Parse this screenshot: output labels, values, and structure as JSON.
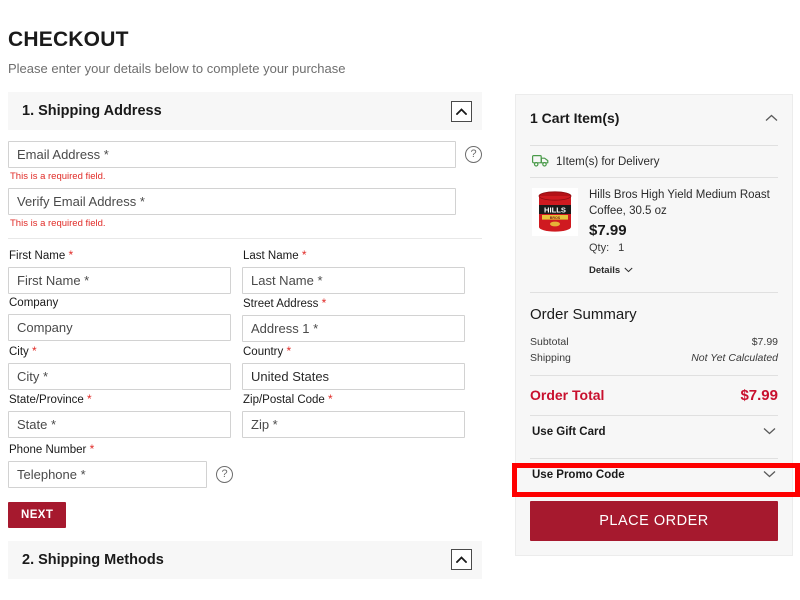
{
  "header": {
    "title": "CHECKOUT",
    "subtitle": "Please enter your details below to complete your purchase"
  },
  "colors": {
    "accent_red": "#c8102e",
    "button_red": "#a6192e",
    "error_red": "#e02b27",
    "annotation_red": "#fe0000",
    "panel_bg": "#f7f7f7",
    "truck_green": "#4a9a4a"
  },
  "shipping_address": {
    "section_number": "1.",
    "section_title": "1. Shipping Address",
    "collapse_icon": "chevron-up-icon",
    "email": {
      "placeholder": "Email Address *",
      "value": "",
      "error": "This is a required field.",
      "help_icon": "question-mark-icon"
    },
    "verify_email": {
      "placeholder": "Verify Email Address *",
      "value": "",
      "error": "This is a required field."
    },
    "fields": [
      {
        "label": "First Name",
        "required": true,
        "placeholder": "First Name *",
        "value": ""
      },
      {
        "label": "Last Name",
        "required": true,
        "placeholder": "Last Name *",
        "value": ""
      },
      {
        "label": "Company",
        "required": false,
        "placeholder": "Company",
        "value": ""
      },
      {
        "label": "Street Address",
        "required": true,
        "placeholder": "Address 1 *",
        "value": ""
      },
      {
        "label": "City",
        "required": true,
        "placeholder": "City *",
        "value": ""
      },
      {
        "label": "Country",
        "required": true,
        "placeholder": "Country",
        "value": "United States"
      },
      {
        "label": "State/Province",
        "required": true,
        "placeholder": "State *",
        "value": ""
      },
      {
        "label": "Zip/Postal Code",
        "required": true,
        "placeholder": "Zip *",
        "value": ""
      }
    ],
    "phone": {
      "label": "Phone Number",
      "required": true,
      "placeholder": "Telephone *",
      "value": "",
      "help_icon": "question-mark-icon"
    },
    "next_button": "NEXT"
  },
  "shipping_methods": {
    "section_title": "2. Shipping Methods",
    "collapse_icon": "chevron-up-icon"
  },
  "cart": {
    "title": "1 Cart Item(s)",
    "collapse_icon": "chevron-up-icon",
    "delivery_line": "1Item(s) for Delivery",
    "delivery_icon": "delivery-truck-icon",
    "product": {
      "image_alt": "hills-bros-coffee-can",
      "brand_line1": "HILLS",
      "brand_line2": "BROS",
      "name": "Hills Bros High Yield Medium Roast Coffee, 30.5 oz",
      "price": "$7.99",
      "qty_label": "Qty:",
      "qty_value": "1",
      "details_label": "Details",
      "details_icon": "chevron-down-icon"
    }
  },
  "order_summary": {
    "title": "Order Summary",
    "lines": [
      {
        "label": "Subtotal",
        "value": "$7.99",
        "italic": false
      },
      {
        "label": "Shipping",
        "value": "Not Yet Calculated",
        "italic": true
      }
    ],
    "total_label": "Order Total",
    "total_value": "$7.99"
  },
  "payment_options": {
    "gift_card": {
      "label": "Use Gift Card",
      "icon": "chevron-down-icon"
    },
    "promo_code": {
      "label": "Use Promo Code",
      "icon": "chevron-down-icon",
      "highlighted": true
    },
    "place_order": "PLACE ORDER"
  }
}
